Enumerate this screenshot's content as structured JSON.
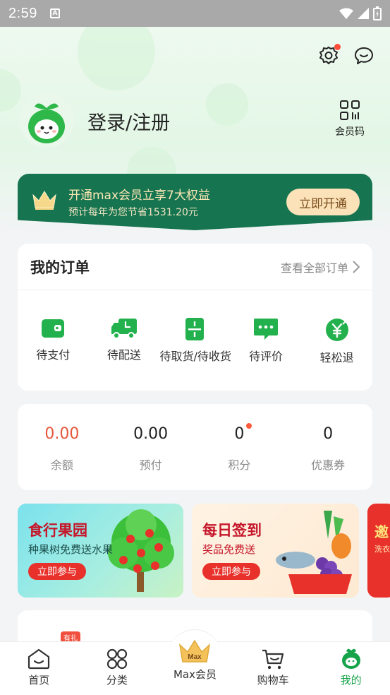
{
  "status_bar": {
    "time": "2:59"
  },
  "header": {
    "login_text": "登录/注册",
    "member_code_label": "会员码"
  },
  "vip_banner": {
    "title": "开通max会员立享7大权益",
    "subtitle": "预计每年为您节省1531.20元",
    "button": "立即开通"
  },
  "orders": {
    "title": "我的订单",
    "view_all": "查看全部订单",
    "items": [
      {
        "label": "待支付",
        "icon": "wallet-icon"
      },
      {
        "label": "待配送",
        "icon": "delivery-truck-icon"
      },
      {
        "label": "待取货/待收货",
        "icon": "pickup-icon"
      },
      {
        "label": "待评价",
        "icon": "comment-icon"
      },
      {
        "label": "轻松退",
        "icon": "refund-icon"
      }
    ]
  },
  "assets": [
    {
      "value": "0.00",
      "label": "余额"
    },
    {
      "value": "0.00",
      "label": "预付"
    },
    {
      "value": "0",
      "label": "积分"
    },
    {
      "value": "0",
      "label": "优惠券"
    }
  ],
  "banners": [
    {
      "title": "食行果园",
      "subtitle": "种果树免费送水果",
      "button": "立即参与"
    },
    {
      "title": "每日签到",
      "subtitle": "奖品免费送",
      "button": "立即参与"
    },
    {
      "title": "邀",
      "subtitle": "洗衣"
    }
  ],
  "promo_tag": "有礼",
  "tab_bar": [
    {
      "label": "首页",
      "icon": "home-icon"
    },
    {
      "label": "分类",
      "icon": "category-icon"
    },
    {
      "label": "Max会员",
      "icon": "crown-icon",
      "badge": "Max"
    },
    {
      "label": "购物车",
      "icon": "cart-icon"
    },
    {
      "label": "我的",
      "icon": "profile-icon"
    }
  ],
  "colors": {
    "brand_green": "#16a34a",
    "vip_green": "#167450",
    "accent_red": "#e4573b"
  }
}
